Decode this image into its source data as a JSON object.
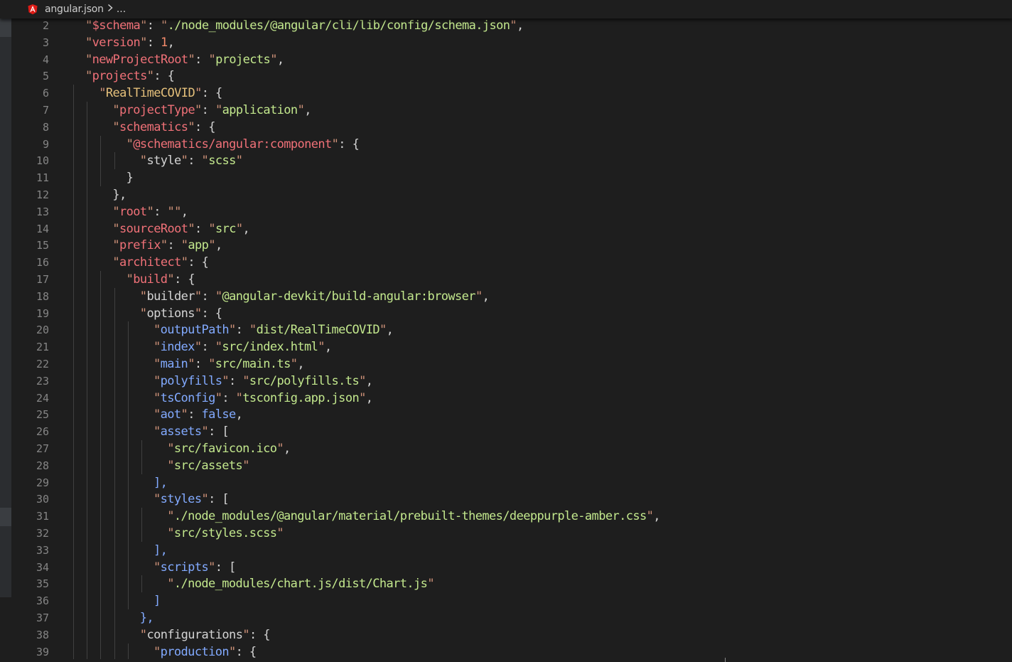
{
  "breadcrumb": {
    "file": "angular.json",
    "separator": "›",
    "more": "..."
  },
  "colors": {
    "key": "#f07178",
    "string": "#c3e88d",
    "number": "#f78c6c",
    "punctuation": "#d4d4d4",
    "line_number": "#858585",
    "background": "#1e1e1e"
  },
  "lines": [
    {
      "num": "2",
      "indent": 0,
      "tokens": [
        [
          "q",
          "\""
        ],
        [
          "k",
          "$schema"
        ],
        [
          "q",
          "\""
        ],
        [
          "p",
          ": "
        ],
        [
          "q",
          "\""
        ],
        [
          "sv",
          "./node_modules/@angular/cli/lib/config/schema.json"
        ],
        [
          "q",
          "\""
        ],
        [
          "p",
          ","
        ]
      ]
    },
    {
      "num": "3",
      "indent": 0,
      "tokens": [
        [
          "q",
          "\""
        ],
        [
          "k",
          "version"
        ],
        [
          "q",
          "\""
        ],
        [
          "p",
          ": "
        ],
        [
          "n",
          "1"
        ],
        [
          "p",
          ","
        ]
      ]
    },
    {
      "num": "4",
      "indent": 0,
      "tokens": [
        [
          "q",
          "\""
        ],
        [
          "k",
          "newProjectRoot"
        ],
        [
          "q",
          "\""
        ],
        [
          "p",
          ": "
        ],
        [
          "q",
          "\""
        ],
        [
          "sv",
          "projects"
        ],
        [
          "q",
          "\""
        ],
        [
          "p",
          ","
        ]
      ]
    },
    {
      "num": "5",
      "indent": 0,
      "tokens": [
        [
          "q",
          "\""
        ],
        [
          "k",
          "projects"
        ],
        [
          "q",
          "\""
        ],
        [
          "p",
          ": {"
        ]
      ]
    },
    {
      "num": "6",
      "indent": 1,
      "tokens": [
        [
          "q",
          "\""
        ],
        [
          "s",
          "RealTimeCOVID"
        ],
        [
          "q",
          "\""
        ],
        [
          "p",
          ": {"
        ]
      ]
    },
    {
      "num": "7",
      "indent": 2,
      "tokens": [
        [
          "q",
          "\""
        ],
        [
          "k",
          "projectType"
        ],
        [
          "q",
          "\""
        ],
        [
          "p",
          ": "
        ],
        [
          "q",
          "\""
        ],
        [
          "sv",
          "application"
        ],
        [
          "q",
          "\""
        ],
        [
          "p",
          ","
        ]
      ]
    },
    {
      "num": "8",
      "indent": 2,
      "tokens": [
        [
          "q",
          "\""
        ],
        [
          "k",
          "schematics"
        ],
        [
          "q",
          "\""
        ],
        [
          "p",
          ": {"
        ]
      ]
    },
    {
      "num": "9",
      "indent": 3,
      "tokens": [
        [
          "q",
          "\""
        ],
        [
          "kr",
          "@schematics/angular:component"
        ],
        [
          "q",
          "\""
        ],
        [
          "p",
          ": {"
        ]
      ]
    },
    {
      "num": "10",
      "indent": 4,
      "tokens": [
        [
          "q",
          "\""
        ],
        [
          "p",
          "style"
        ],
        [
          "q",
          "\""
        ],
        [
          "p",
          ": "
        ],
        [
          "q",
          "\""
        ],
        [
          "sv",
          "scss"
        ],
        [
          "q",
          "\""
        ]
      ]
    },
    {
      "num": "11",
      "indent": 3,
      "tokens": [
        [
          "p",
          "}"
        ]
      ]
    },
    {
      "num": "12",
      "indent": 2,
      "tokens": [
        [
          "p",
          "},"
        ]
      ]
    },
    {
      "num": "13",
      "indent": 2,
      "tokens": [
        [
          "q",
          "\""
        ],
        [
          "k",
          "root"
        ],
        [
          "q",
          "\""
        ],
        [
          "p",
          ": "
        ],
        [
          "q",
          "\"\""
        ],
        [
          "p",
          ","
        ]
      ]
    },
    {
      "num": "14",
      "indent": 2,
      "tokens": [
        [
          "q",
          "\""
        ],
        [
          "k",
          "sourceRoot"
        ],
        [
          "q",
          "\""
        ],
        [
          "p",
          ": "
        ],
        [
          "q",
          "\""
        ],
        [
          "sv",
          "src"
        ],
        [
          "q",
          "\""
        ],
        [
          "p",
          ","
        ]
      ]
    },
    {
      "num": "15",
      "indent": 2,
      "tokens": [
        [
          "q",
          "\""
        ],
        [
          "k",
          "prefix"
        ],
        [
          "q",
          "\""
        ],
        [
          "p",
          ": "
        ],
        [
          "q",
          "\""
        ],
        [
          "sv",
          "app"
        ],
        [
          "q",
          "\""
        ],
        [
          "p",
          ","
        ]
      ]
    },
    {
      "num": "16",
      "indent": 2,
      "tokens": [
        [
          "q",
          "\""
        ],
        [
          "k",
          "architect"
        ],
        [
          "q",
          "\""
        ],
        [
          "p",
          ": {"
        ]
      ]
    },
    {
      "num": "17",
      "indent": 3,
      "tokens": [
        [
          "q",
          "\""
        ],
        [
          "k",
          "build"
        ],
        [
          "q",
          "\""
        ],
        [
          "p",
          ": {"
        ]
      ]
    },
    {
      "num": "18",
      "indent": 4,
      "tokens": [
        [
          "q",
          "\""
        ],
        [
          "p",
          "builder"
        ],
        [
          "q",
          "\""
        ],
        [
          "p",
          ": "
        ],
        [
          "q",
          "\""
        ],
        [
          "sv",
          "@angular-devkit/build-angular:browser"
        ],
        [
          "q",
          "\""
        ],
        [
          "p",
          ","
        ]
      ]
    },
    {
      "num": "19",
      "indent": 4,
      "tokens": [
        [
          "q",
          "\""
        ],
        [
          "p",
          "options"
        ],
        [
          "q",
          "\""
        ],
        [
          "p",
          ": {"
        ]
      ]
    },
    {
      "num": "20",
      "indent": 5,
      "tokens": [
        [
          "q",
          "\""
        ],
        [
          "kw",
          "outputPath"
        ],
        [
          "q",
          "\""
        ],
        [
          "p",
          ": "
        ],
        [
          "q",
          "\""
        ],
        [
          "sv",
          "dist/RealTimeCOVID"
        ],
        [
          "q",
          "\""
        ],
        [
          "p",
          ","
        ]
      ]
    },
    {
      "num": "21",
      "indent": 5,
      "tokens": [
        [
          "q",
          "\""
        ],
        [
          "kw",
          "index"
        ],
        [
          "q",
          "\""
        ],
        [
          "p",
          ": "
        ],
        [
          "q",
          "\""
        ],
        [
          "sv",
          "src/index.html"
        ],
        [
          "q",
          "\""
        ],
        [
          "p",
          ","
        ]
      ]
    },
    {
      "num": "22",
      "indent": 5,
      "tokens": [
        [
          "q",
          "\""
        ],
        [
          "kw",
          "main"
        ],
        [
          "q",
          "\""
        ],
        [
          "p",
          ": "
        ],
        [
          "q",
          "\""
        ],
        [
          "sv",
          "src/main.ts"
        ],
        [
          "q",
          "\""
        ],
        [
          "p",
          ","
        ]
      ]
    },
    {
      "num": "23",
      "indent": 5,
      "tokens": [
        [
          "q",
          "\""
        ],
        [
          "kw",
          "polyfills"
        ],
        [
          "q",
          "\""
        ],
        [
          "p",
          ": "
        ],
        [
          "q",
          "\""
        ],
        [
          "sv",
          "src/polyfills.ts"
        ],
        [
          "q",
          "\""
        ],
        [
          "p",
          ","
        ]
      ]
    },
    {
      "num": "24",
      "indent": 5,
      "tokens": [
        [
          "q",
          "\""
        ],
        [
          "kw",
          "tsConfig"
        ],
        [
          "q",
          "\""
        ],
        [
          "p",
          ": "
        ],
        [
          "q",
          "\""
        ],
        [
          "sv",
          "tsconfig.app.json"
        ],
        [
          "q",
          "\""
        ],
        [
          "p",
          ","
        ]
      ]
    },
    {
      "num": "25",
      "indent": 5,
      "tokens": [
        [
          "q",
          "\""
        ],
        [
          "kw",
          "aot"
        ],
        [
          "q",
          "\""
        ],
        [
          "p",
          ": "
        ],
        [
          "kw",
          "false"
        ],
        [
          "p",
          ","
        ]
      ]
    },
    {
      "num": "26",
      "indent": 5,
      "tokens": [
        [
          "q",
          "\""
        ],
        [
          "kw",
          "assets"
        ],
        [
          "q",
          "\""
        ],
        [
          "p",
          ": ["
        ]
      ]
    },
    {
      "num": "27",
      "indent": 6,
      "tokens": [
        [
          "q",
          "\""
        ],
        [
          "sv",
          "src/favicon.ico"
        ],
        [
          "q",
          "\""
        ],
        [
          "p",
          ","
        ]
      ]
    },
    {
      "num": "28",
      "indent": 6,
      "tokens": [
        [
          "q",
          "\""
        ],
        [
          "sv",
          "src/assets"
        ],
        [
          "q",
          "\""
        ]
      ]
    },
    {
      "num": "29",
      "indent": 5,
      "tokens": [
        [
          "kw",
          "],"
        ]
      ]
    },
    {
      "num": "30",
      "indent": 5,
      "tokens": [
        [
          "q",
          "\""
        ],
        [
          "kw",
          "styles"
        ],
        [
          "q",
          "\""
        ],
        [
          "p",
          ": ["
        ]
      ]
    },
    {
      "num": "31",
      "indent": 6,
      "tokens": [
        [
          "q",
          "\""
        ],
        [
          "sv",
          "./node_modules/@angular/material/prebuilt-themes/deeppurple-amber.css"
        ],
        [
          "q",
          "\""
        ],
        [
          "p",
          ","
        ]
      ]
    },
    {
      "num": "32",
      "indent": 6,
      "tokens": [
        [
          "q",
          "\""
        ],
        [
          "sv",
          "src/styles.scss"
        ],
        [
          "q",
          "\""
        ]
      ]
    },
    {
      "num": "33",
      "indent": 5,
      "tokens": [
        [
          "kw",
          "],"
        ]
      ]
    },
    {
      "num": "34",
      "indent": 5,
      "tokens": [
        [
          "q",
          "\""
        ],
        [
          "kw",
          "scripts"
        ],
        [
          "q",
          "\""
        ],
        [
          "p",
          ": ["
        ]
      ]
    },
    {
      "num": "35",
      "indent": 6,
      "tokens": [
        [
          "q",
          "\""
        ],
        [
          "sv",
          "./node_modules/chart.js/dist/Chart.js"
        ],
        [
          "q",
          "\""
        ]
      ]
    },
    {
      "num": "36",
      "indent": 5,
      "tokens": [
        [
          "kw",
          "]"
        ]
      ]
    },
    {
      "num": "37",
      "indent": 4,
      "tokens": [
        [
          "kw",
          "},"
        ]
      ]
    },
    {
      "num": "38",
      "indent": 4,
      "tokens": [
        [
          "q",
          "\""
        ],
        [
          "p",
          "configurations"
        ],
        [
          "q",
          "\""
        ],
        [
          "p",
          ": {"
        ]
      ]
    },
    {
      "num": "39",
      "indent": 5,
      "tokens": [
        [
          "q",
          "\""
        ],
        [
          "kw",
          "production"
        ],
        [
          "q",
          "\""
        ],
        [
          "p",
          ": {"
        ]
      ]
    }
  ]
}
